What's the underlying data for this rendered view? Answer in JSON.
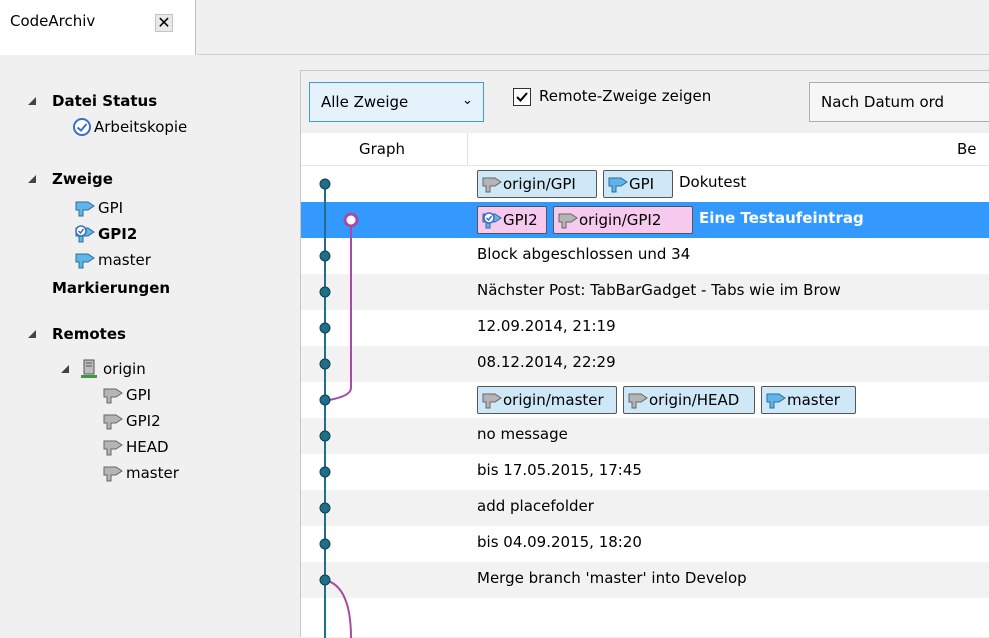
{
  "tab": {
    "title": "CodeArchiv",
    "close": "✕"
  },
  "sidebar": {
    "datei_status": {
      "label": "Datei Status",
      "items": [
        "Arbeitskopie"
      ]
    },
    "zweige": {
      "label": "Zweige",
      "items": [
        "GPI",
        "GPI2",
        "master"
      ]
    },
    "markierungen": {
      "label": "Markierungen"
    },
    "remotes": {
      "label": "Remotes",
      "origin": {
        "label": "origin",
        "items": [
          "GPI",
          "GPI2",
          "HEAD",
          "master"
        ]
      }
    }
  },
  "toolbar": {
    "branch_filter": "Alle Zweige",
    "show_remote_label": "Remote-Zweige zeigen",
    "show_remote_checked": true,
    "sort_label": "Nach Datum ord"
  },
  "columns": {
    "graph": "Graph",
    "description": "Be"
  },
  "commits": [
    {
      "badges": [
        {
          "text": "origin/GPI",
          "type": "remote"
        },
        {
          "text": "GPI",
          "type": "local"
        }
      ],
      "message": "Dokutest"
    },
    {
      "badges": [
        {
          "text": "GPI2",
          "type": "current"
        },
        {
          "text": "origin/GPI2",
          "type": "remote-current"
        }
      ],
      "message": "Eine Testaufeintrag",
      "selected": true
    },
    {
      "badges": [],
      "message": "Block abgeschlossen und 34"
    },
    {
      "badges": [],
      "message": "Nächster Post: TabBarGadget - Tabs wie im Brow"
    },
    {
      "badges": [],
      "message": "12.09.2014, 21:19"
    },
    {
      "badges": [],
      "message": "08.12.2014, 22:29"
    },
    {
      "badges": [
        {
          "text": "origin/master",
          "type": "remote"
        },
        {
          "text": "origin/HEAD",
          "type": "remote"
        },
        {
          "text": "master",
          "type": "local"
        }
      ],
      "message": ""
    },
    {
      "badges": [],
      "message": "no message"
    },
    {
      "badges": [],
      "message": "bis 17.05.2015, 17:45"
    },
    {
      "badges": [],
      "message": "add placefolder"
    },
    {
      "badges": [],
      "message": "bis 04.09.2015, 18:20"
    },
    {
      "badges": [],
      "message": "Merge branch 'master' into Develop"
    }
  ],
  "colors": {
    "selection": "#3399ff",
    "graph_main": "#1f6f8b",
    "graph_branch": "#a64ca6",
    "badge_blue": "#cfe8f7",
    "badge_pink": "#f7c9ef"
  }
}
